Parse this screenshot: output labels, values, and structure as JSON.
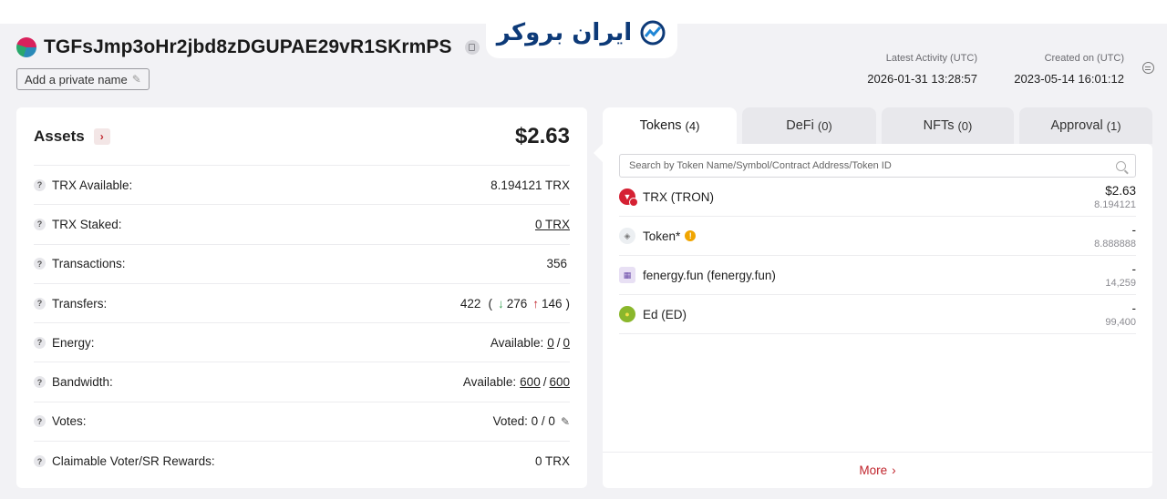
{
  "header": {
    "address": "TGFsJmp3oHr2jbd8zDGUPAE29vR1SKrmPS",
    "private_name_label": "Add a private name",
    "latest_activity_label": "Latest Activity (UTC)",
    "latest_activity_value": "2026-01-31 13:28:57",
    "created_on_label": "Created on (UTC)",
    "created_on_value": "2023-05-14 16:01:12"
  },
  "logo": {
    "text": "ایران بروکر"
  },
  "assets": {
    "title": "Assets",
    "total": "$2.63",
    "rows": {
      "trx_available": {
        "label": "TRX Available:",
        "value": "8.194121 TRX"
      },
      "trx_staked": {
        "label": "TRX Staked:",
        "value": "0 TRX"
      },
      "transactions": {
        "label": "Transactions:",
        "value": "356"
      },
      "transfers": {
        "label": "Transfers:",
        "total": "422",
        "in": "276",
        "out": "146"
      },
      "energy": {
        "label": "Energy:",
        "prefix": "Available:",
        "used": "0",
        "total": "0"
      },
      "bandwidth": {
        "label": "Bandwidth:",
        "prefix": "Available:",
        "used": "600",
        "total": "600"
      },
      "votes": {
        "label": "Votes:",
        "value": "Voted: 0 / 0"
      },
      "rewards": {
        "label": "Claimable Voter/SR Rewards:",
        "value": "0 TRX"
      }
    }
  },
  "tabs": [
    {
      "label": "Tokens",
      "count": "(4)"
    },
    {
      "label": "DeFi",
      "count": "(0)"
    },
    {
      "label": "NFTs",
      "count": "(0)"
    },
    {
      "label": "Approval",
      "count": "(1)"
    }
  ],
  "search": {
    "placeholder": "Search by Token Name/Symbol/Contract Address/Token ID"
  },
  "tokens": [
    {
      "name": "TRX (TRON)",
      "value": "$2.63",
      "amount": "8.194121"
    },
    {
      "name": "Token*",
      "value": "-",
      "amount": "8.888888"
    },
    {
      "name": "fenergy.fun (fenergy.fun)",
      "value": "-",
      "amount": "14,259"
    },
    {
      "name": "Ed (ED)",
      "value": "-",
      "amount": "99,400"
    }
  ],
  "more_label": "More",
  "icons": {
    "copy": "copy-icon",
    "edit": "pencil-icon",
    "settings": "settings-icon",
    "search": "search-icon",
    "warning": "warning-icon",
    "arrow_in": "arrow-down-icon",
    "arrow_out": "arrow-up-icon"
  },
  "colors": {
    "accent": "#c0242c",
    "green": "#2e9d4b",
    "logo": "#0d3a78"
  }
}
